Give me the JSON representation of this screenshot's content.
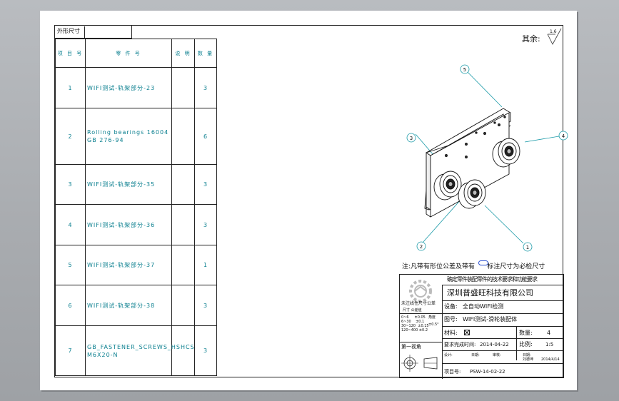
{
  "bom": {
    "title": "外形尺寸",
    "headers": [
      "项 目 号",
      "零 件 号",
      "说 明",
      "数 量"
    ],
    "rows": [
      {
        "item": "1",
        "part": "WIFI测试-轨架部分-23",
        "desc": "",
        "qty": "3"
      },
      {
        "item": "2",
        "part": "Rolling bearings 16004 GB 276-94",
        "desc": "",
        "qty": "6"
      },
      {
        "item": "3",
        "part": "WIFI测试-轨架部分-35",
        "desc": "",
        "qty": "3"
      },
      {
        "item": "4",
        "part": "WIFI测试-轨架部分-36",
        "desc": "",
        "qty": "3"
      },
      {
        "item": "5",
        "part": "WIFI测试-轨架部分-37",
        "desc": "",
        "qty": "1"
      },
      {
        "item": "6",
        "part": "WIFI测试-轨架部分-38",
        "desc": "",
        "qty": "3"
      },
      {
        "item": "7",
        "part": "GB_FASTENER_SCREWS_HSHCS M6X20-N",
        "desc": "",
        "qty": "3"
      }
    ]
  },
  "roughness": {
    "label": "其余:",
    "value": "1.6"
  },
  "balloons": [
    "5",
    "3",
    "4",
    "2",
    "1"
  ],
  "note": "注:凡带有形位公差及带有      标注尺寸为必检尺寸",
  "title_block": {
    "garbled_header": "确定零件装配零件的技术要求和功能要求",
    "company": "深圳普盛旺科技有限公司",
    "equipment_label": "设备:",
    "equipment_value": "全自动WIFI检测",
    "drawing_label": "图号:",
    "drawing_value": "WIFI测试-滑轮装配体",
    "material_label": "材料:",
    "quantity_label": "数量:",
    "quantity_value": "4",
    "due_label": "要求完成时间:",
    "due_value": "2014-04-22",
    "scale_label": "比例:",
    "scale_value": "1:5",
    "design_label": "设计:",
    "date_label": "日期:",
    "check_label": "审核:",
    "date_label2": "日期:",
    "approve_label": "刘德坤",
    "approve_date": "2014/4/14",
    "project_label": "项目号:",
    "project_value": "PSW-14-02-22",
    "tolerance_title": "未注线性尺寸公差",
    "tolerance_subtitle": "尺寸 公差值",
    "tolerance_rows": [
      "0~6     ±0.05",
      "6~30    ±0.1",
      "30~120  ±0.15",
      "120~400 ±0.2"
    ],
    "angle_label": "角度",
    "angle_value": "±0.5°",
    "projection_label": "第一视角"
  },
  "colors": {
    "leader": "#1a9aa8",
    "text": "#0a7f8f",
    "line": "#222222"
  }
}
